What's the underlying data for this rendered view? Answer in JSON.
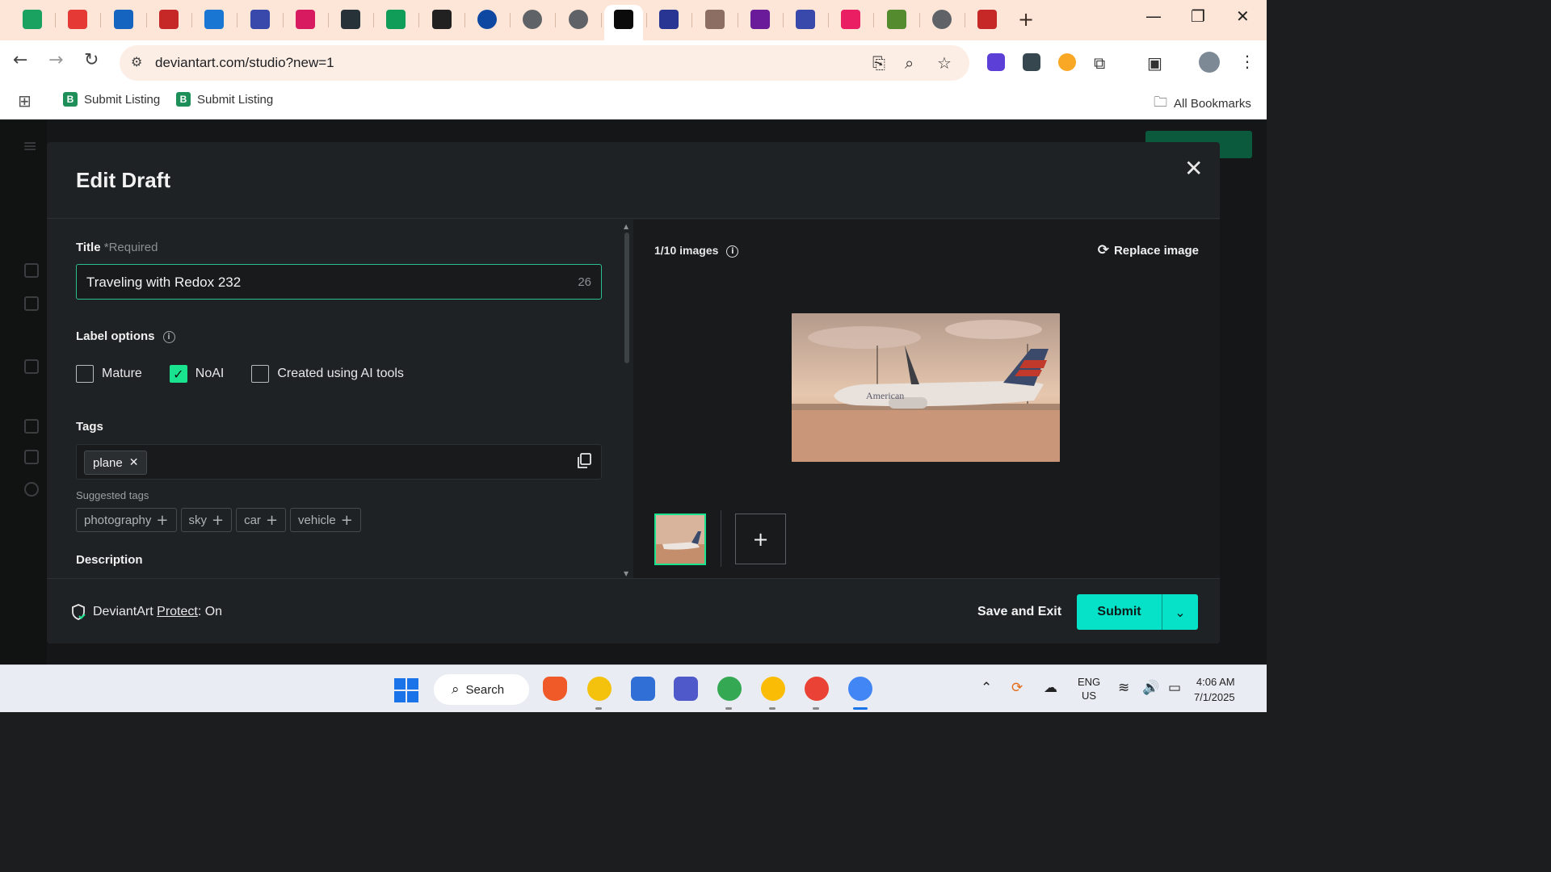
{
  "browser": {
    "url": "deviantart.com/studio?new=1",
    "bookmarks": [
      "Submit Listing",
      "Submit Listing"
    ],
    "all_bookmarks_label": "All Bookmarks",
    "new_tab_symbol": "+",
    "tabs_icon_colors": [
      "#1aa260",
      "#e53935",
      "#1565c0",
      "#c62828",
      "#1976d2",
      "#3949ab",
      "#d81b60",
      "#263238",
      "#0f9d58",
      "#212121",
      "#0d47a1",
      "#5f6368",
      "#5f6368",
      "#0b0b0b",
      "#283593",
      "#8d6e63",
      "#6a1b9a",
      "#3949ab",
      "#e91e63",
      "#558b2f",
      "#5f6368",
      "#c62828"
    ]
  },
  "modal": {
    "title": "Edit Draft",
    "close_symbol": "✕",
    "title_field": {
      "label": "Title",
      "required_note": "*Required",
      "value": "Traveling with Redox 232",
      "char_count": "26"
    },
    "label_options": {
      "label": "Label options",
      "options": [
        {
          "label": "Mature",
          "checked": false
        },
        {
          "label": "NoAI",
          "checked": true
        },
        {
          "label": "Created using AI tools",
          "checked": false
        }
      ]
    },
    "tags": {
      "label": "Tags",
      "current": [
        {
          "label": "plane",
          "remove_symbol": "✕"
        }
      ],
      "suggested_label": "Suggested tags",
      "suggested": [
        "photography",
        "sky",
        "car",
        "vehicle"
      ]
    },
    "description_label": "Description",
    "preview": {
      "image_count": "1/10 images",
      "replace_label": "Replace image",
      "add_symbol": "+"
    },
    "footer": {
      "protect_prefix": "DeviantArt",
      "protect_link": "Protect",
      "protect_suffix": ": On",
      "save_exit": "Save and Exit",
      "submit": "Submit"
    }
  },
  "taskbar": {
    "search_label": "Search",
    "lang_line1": "ENG",
    "lang_line2": "US",
    "time": "4:06 AM",
    "date": "7/1/2025"
  }
}
